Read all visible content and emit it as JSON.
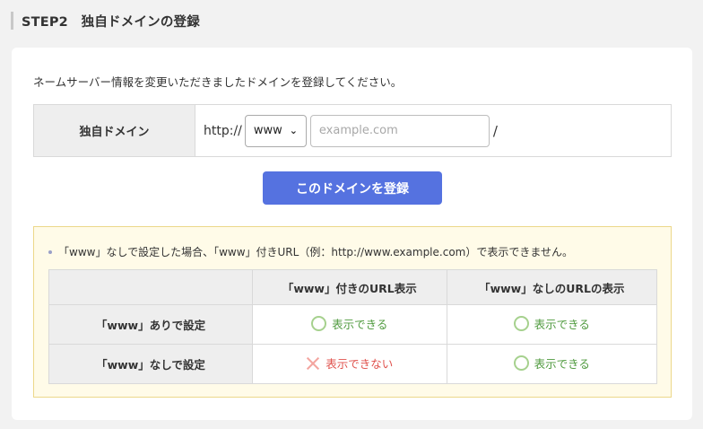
{
  "header": {
    "title": "STEP2　独自ドメインの登録"
  },
  "intro": "ネームサーバー情報を変更いただきましたドメインを登録してください。",
  "domain_form": {
    "label": "独自ドメイン",
    "protocol": "http://",
    "www_select_value": "www",
    "domain_placeholder": "example.com",
    "slash": "/"
  },
  "register_button": "このドメインを登録",
  "notice": {
    "text": "「www」なしで設定した場合、「www」付きURL（例：http://www.example.com）で表示できません。",
    "table": {
      "headers": [
        "",
        "「www」付きのURL表示",
        "「www」なしのURLの表示"
      ],
      "rows": [
        {
          "label": "「www」ありで設定",
          "cells": [
            {
              "status": "ok",
              "text": "表示できる"
            },
            {
              "status": "ok",
              "text": "表示できる"
            }
          ]
        },
        {
          "label": "「www」なしで設定",
          "cells": [
            {
              "status": "ng",
              "text": "表示できない"
            },
            {
              "status": "ok",
              "text": "表示できる"
            }
          ]
        }
      ]
    }
  },
  "colors": {
    "primary_button": "#5572e0",
    "ok": "#4f9a3e",
    "ng": "#e0524d",
    "notice_bg": "#fffbe8"
  }
}
